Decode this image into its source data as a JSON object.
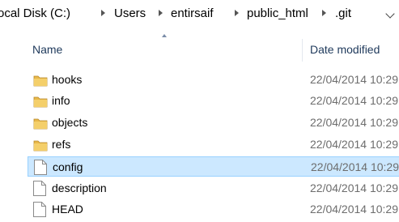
{
  "breadcrumb": {
    "items": [
      "ocal Disk (C:)",
      "Users",
      "entirsaif",
      "public_html",
      ".git"
    ]
  },
  "columns": {
    "name": "Name",
    "date_modified": "Date modified"
  },
  "files": [
    {
      "name": "hooks",
      "type": "folder",
      "date": "22/04/2014 10:29"
    },
    {
      "name": "info",
      "type": "folder",
      "date": "22/04/2014 10:29"
    },
    {
      "name": "objects",
      "type": "folder",
      "date": "22/04/2014 10:29"
    },
    {
      "name": "refs",
      "type": "folder",
      "date": "22/04/2014 10:29"
    },
    {
      "name": "config",
      "type": "file",
      "date": "22/04/2014 10:29",
      "selected": true
    },
    {
      "name": "description",
      "type": "file",
      "date": "22/04/2014 10:29"
    },
    {
      "name": "HEAD",
      "type": "file",
      "date": "22/04/2014 10:29"
    }
  ],
  "colors": {
    "selection_bg": "#cce8ff",
    "selection_border": "#99d1ff",
    "folder": "#e8b84a",
    "header_text": "#1e395b"
  }
}
